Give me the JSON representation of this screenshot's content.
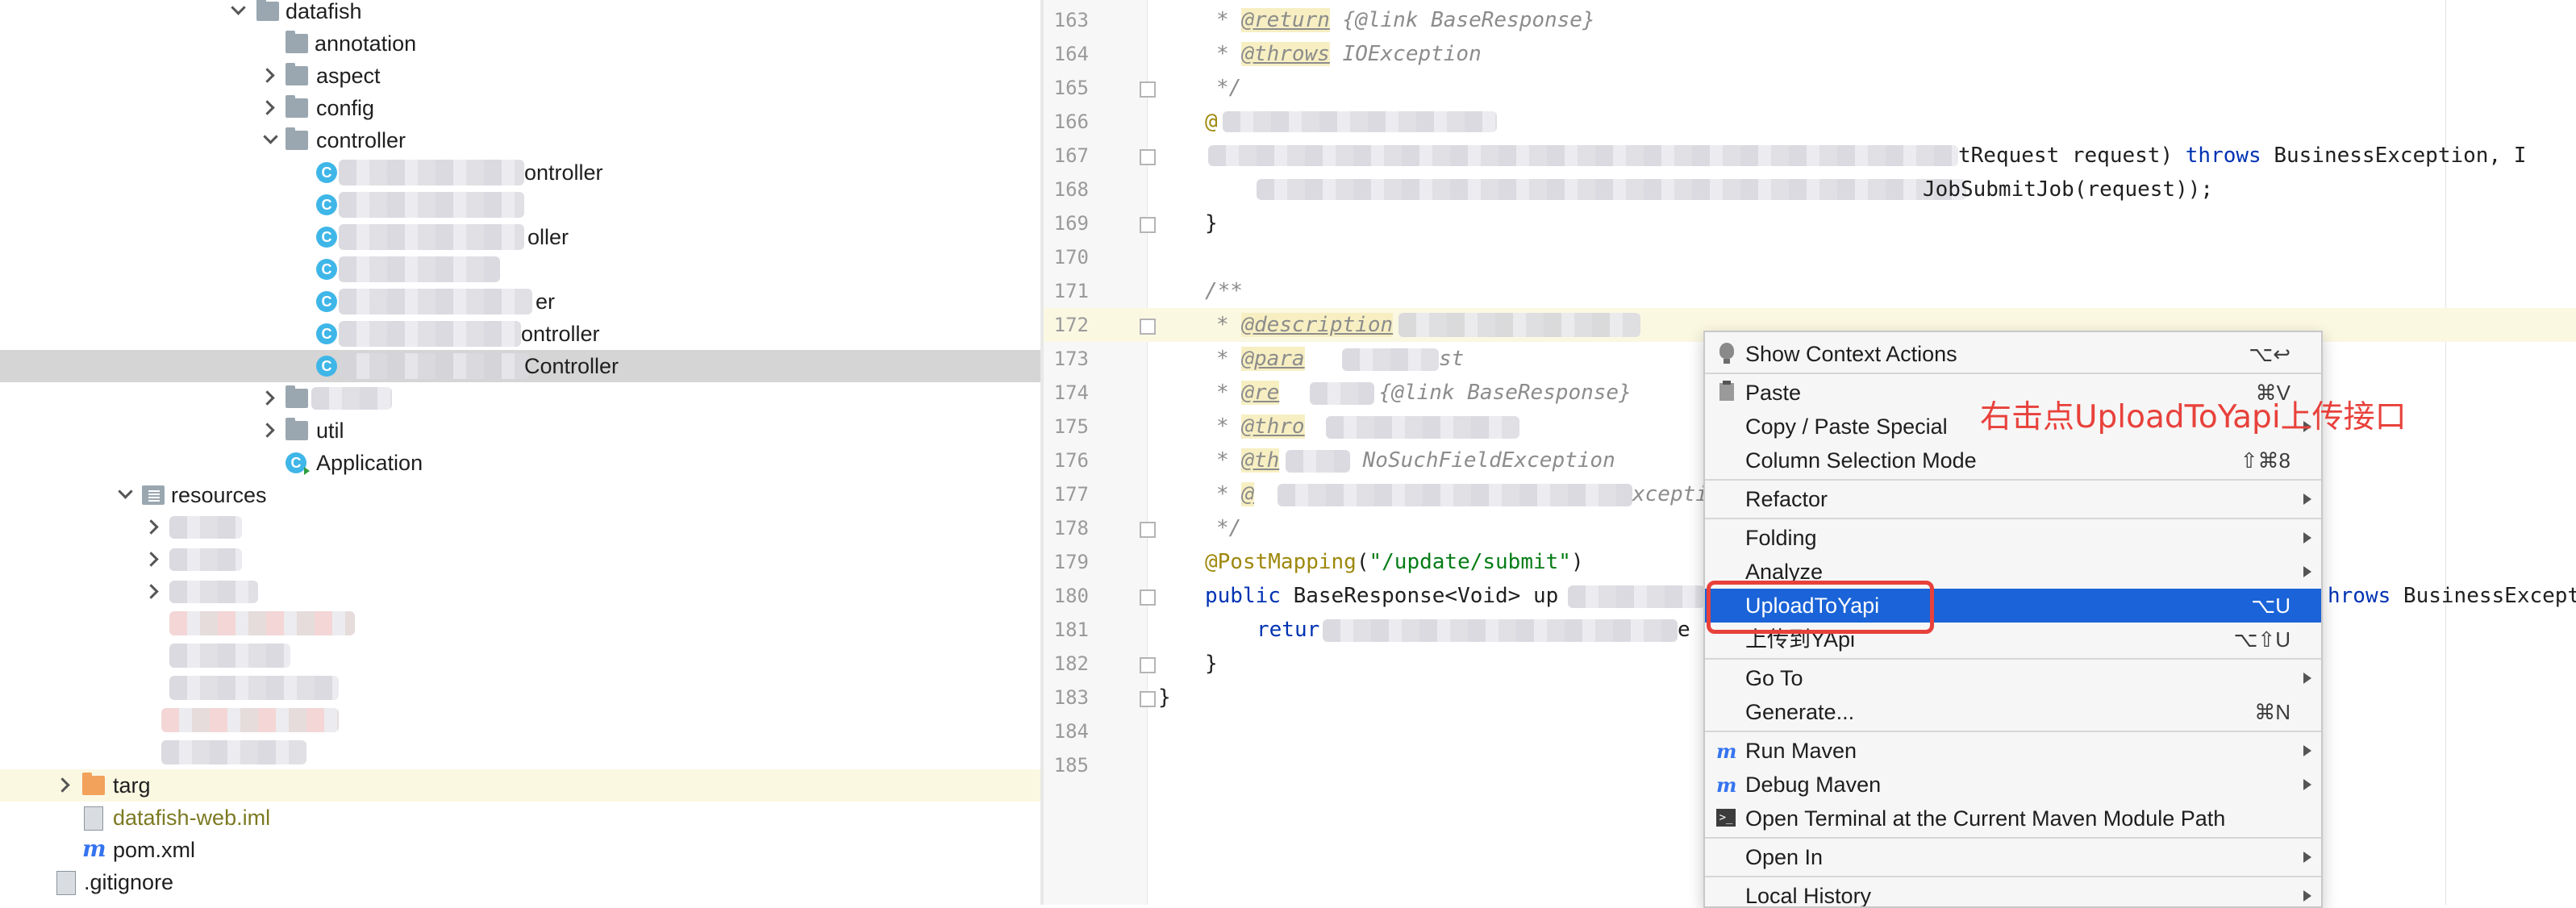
{
  "project_tree": {
    "items": [
      {
        "label": "datafish",
        "y": -6
      },
      {
        "label": "annotation"
      },
      {
        "label": "aspect"
      },
      {
        "label": "config"
      },
      {
        "label": "controller"
      },
      {
        "label": "ontroller"
      },
      {
        "label": "oller"
      },
      {
        "label": "er"
      },
      {
        "label": "ontroller"
      },
      {
        "label": "Controller"
      },
      {
        "label": "util"
      },
      {
        "label": "Application"
      },
      {
        "label": "resources"
      },
      {
        "label": "targ"
      },
      {
        "label": "datafish-web.iml"
      },
      {
        "label": "pom.xml"
      },
      {
        "label": ".gitignore"
      }
    ]
  },
  "editor": {
    "lines": [
      {
        "n": "163",
        "t": [
          "* ",
          "@return",
          " {@link ",
          "BaseResponse",
          "}"
        ]
      },
      {
        "n": "164",
        "t": [
          "* ",
          "@throws",
          " ",
          "IOException"
        ]
      },
      {
        "n": "165",
        "t": [
          "*/"
        ]
      },
      {
        "n": "166",
        "t": [
          "@"
        ]
      },
      {
        "n": "167",
        "t": [
          "tRequest request) ",
          "throws",
          " BusinessException, I"
        ]
      },
      {
        "n": "168",
        "t": [
          "JobSubmitJob(request));"
        ]
      },
      {
        "n": "169",
        "t": [
          "}"
        ]
      },
      {
        "n": "170",
        "t": [
          ""
        ]
      },
      {
        "n": "171",
        "t": [
          "/**"
        ]
      },
      {
        "n": "172",
        "t": [
          "* ",
          "@description"
        ]
      },
      {
        "n": "173",
        "t": [
          "* ",
          "@para",
          "st"
        ]
      },
      {
        "n": "174",
        "t": [
          "* ",
          "@re",
          " {@link ",
          "BaseResponse",
          "}"
        ]
      },
      {
        "n": "175",
        "t": [
          "* ",
          "@thro"
        ]
      },
      {
        "n": "176",
        "t": [
          "* ",
          "@th",
          " NoSuchFieldException"
        ]
      },
      {
        "n": "177",
        "t": [
          "* ",
          "@",
          "xception"
        ]
      },
      {
        "n": "178",
        "t": [
          "*/"
        ]
      },
      {
        "n": "179",
        "t": [
          "@PostMapping",
          "(",
          "\"/update/submit\"",
          ")"
        ]
      },
      {
        "n": "180",
        "t": [
          "public",
          " BaseResponse<Void> up",
          "hrows",
          " BusinessExcept"
        ]
      },
      {
        "n": "181",
        "t": [
          "retur",
          "e"
        ]
      },
      {
        "n": "182",
        "t": [
          "}"
        ]
      },
      {
        "n": "183",
        "t": [
          "}"
        ]
      },
      {
        "n": "184",
        "t": [
          ""
        ]
      },
      {
        "n": "185",
        "t": [
          ""
        ]
      }
    ]
  },
  "context_menu": {
    "items": [
      {
        "label": "Show Context Actions",
        "shortcut": "⌥↩",
        "icon": "bulb-icon"
      },
      {
        "label": "Paste",
        "shortcut": "⌘V",
        "icon": "paste-icon"
      },
      {
        "label": "Copy / Paste Special",
        "submenu": true
      },
      {
        "label": "Column Selection Mode",
        "shortcut": "⇧⌘8"
      },
      {
        "label": "Refactor",
        "submenu": true
      },
      {
        "label": "Folding",
        "submenu": true
      },
      {
        "label": "Analyze",
        "submenu": true
      },
      {
        "label": "UploadToYapi",
        "shortcut": "⌥U",
        "highlighted": true
      },
      {
        "label": "上传到YApi",
        "shortcut": "⌥⇧U"
      },
      {
        "label": "Go To",
        "submenu": true
      },
      {
        "label": "Generate...",
        "shortcut": "⌘N"
      },
      {
        "label": "Run Maven",
        "submenu": true,
        "icon": "maven-icon"
      },
      {
        "label": "Debug Maven",
        "submenu": true,
        "icon": "maven-debug-icon"
      },
      {
        "label": "Open Terminal at the Current Maven Module Path",
        "icon": "terminal-icon"
      },
      {
        "label": "Open In",
        "submenu": true
      },
      {
        "label": "Local History",
        "submenu": true
      }
    ]
  },
  "annotation": {
    "text": "右击点UploadToYapi上传接口",
    "color": "#e8413b"
  },
  "colors": {
    "highlight": "#1a63d8",
    "annotation_red": "#e8413b",
    "current_line": "#fbf8e2"
  }
}
